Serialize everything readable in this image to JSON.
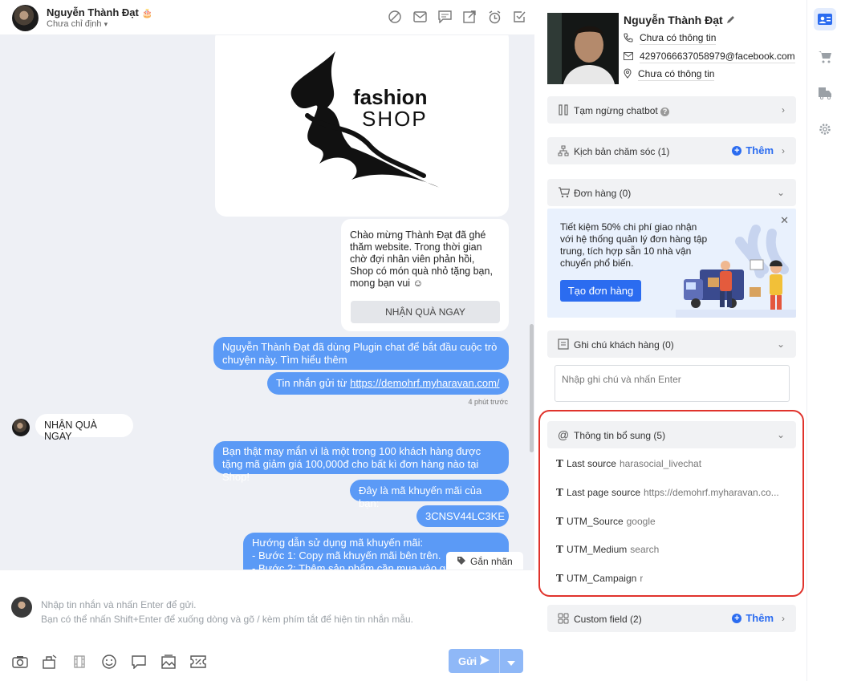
{
  "header": {
    "name": "Nguyễn Thành Đạt",
    "assignee": "Chưa chỉ định"
  },
  "messages": {
    "fashion_logo": {
      "line1": "fashion",
      "line2": "SHOP"
    },
    "welcome_text": "Chào mừng Thành Đạt đã ghé thăm website. Trong thời gian chờ đợi nhân viên phản hồi, Shop có món quà nhỏ tặng bạn, mong bạn vui ☺",
    "gift_button": "NHẬN QUÀ NGAY",
    "plugin_text": "Nguyễn Thành Đạt đã dùng Plugin chat để bắt đầu cuộc trò chuyện này. Tìm hiểu thêm",
    "source_prefix": "Tin nhắn gửi từ ",
    "source_link": "https://demohrf.myharavan.com/",
    "timestamp": "4 phút trước",
    "customer_msg": "NHẬN QUÀ NGAY",
    "lucky_text": "Bạn thật may mắn vì là một trong 100 khách hàng được tặng mã giảm giá 100,000đ cho bất kì đơn hàng nào tại Shop!",
    "code_intro": "Đây là mã khuyến mãi của bạn:",
    "code": "3CNSV44LC3KE",
    "guide_line1": "Hướng dẫn sử dụng mã khuyến mãi:",
    "guide_line2": "- Bước 1: Copy mã khuyến mãi bên trên.",
    "guide_line3": "- Bước 2: Thêm sản phẩm cần mua vào giỏ",
    "tag_button": "Gắn nhãn"
  },
  "composer": {
    "placeholder_line1": "Nhập tin nhắn và nhấn Enter để gửi.",
    "placeholder_line2": "Bạn có thể nhấn Shift+Enter để xuống dòng và gõ / kèm phím tắt để hiện tin nhắn mẫu.",
    "send_label": "Gửi"
  },
  "customer": {
    "name": "Nguyễn Thành Đạt",
    "phone": "Chưa có thông tin",
    "email": "4297066637058979@facebook.com",
    "address": "Chưa có thông tin"
  },
  "sections": {
    "chatbot": "Tạm ngừng chatbot",
    "care": "Kịch bản chăm sóc (1)",
    "add_label": "Thêm",
    "orders": "Đơn hàng (0)",
    "notes": "Ghi chú khách hàng (0)",
    "note_placeholder": "Nhập ghi chú và nhấn Enter",
    "extra": "Thông tin bổ sung (5)",
    "custom": "Custom field (2)"
  },
  "promo": {
    "text": "Tiết kiệm 50% chi phí giao nhận với hệ thống quản lý đơn hàng tập trung, tích hợp sẵn 10 nhà vận chuyển phổ biến.",
    "button": "Tạo đơn hàng"
  },
  "attributes": [
    {
      "key": "Last source",
      "value": "harasocial_livechat"
    },
    {
      "key": "Last page source",
      "value": "https://demohrf.myharavan.co..."
    },
    {
      "key": "UTM_Source",
      "value": "google"
    },
    {
      "key": "UTM_Medium",
      "value": "search"
    },
    {
      "key": "UTM_Campaign",
      "value": "r"
    }
  ],
  "colors": {
    "accent": "#2b6cf0",
    "bubble": "#5b9af6",
    "highlight": "#e0332c"
  }
}
